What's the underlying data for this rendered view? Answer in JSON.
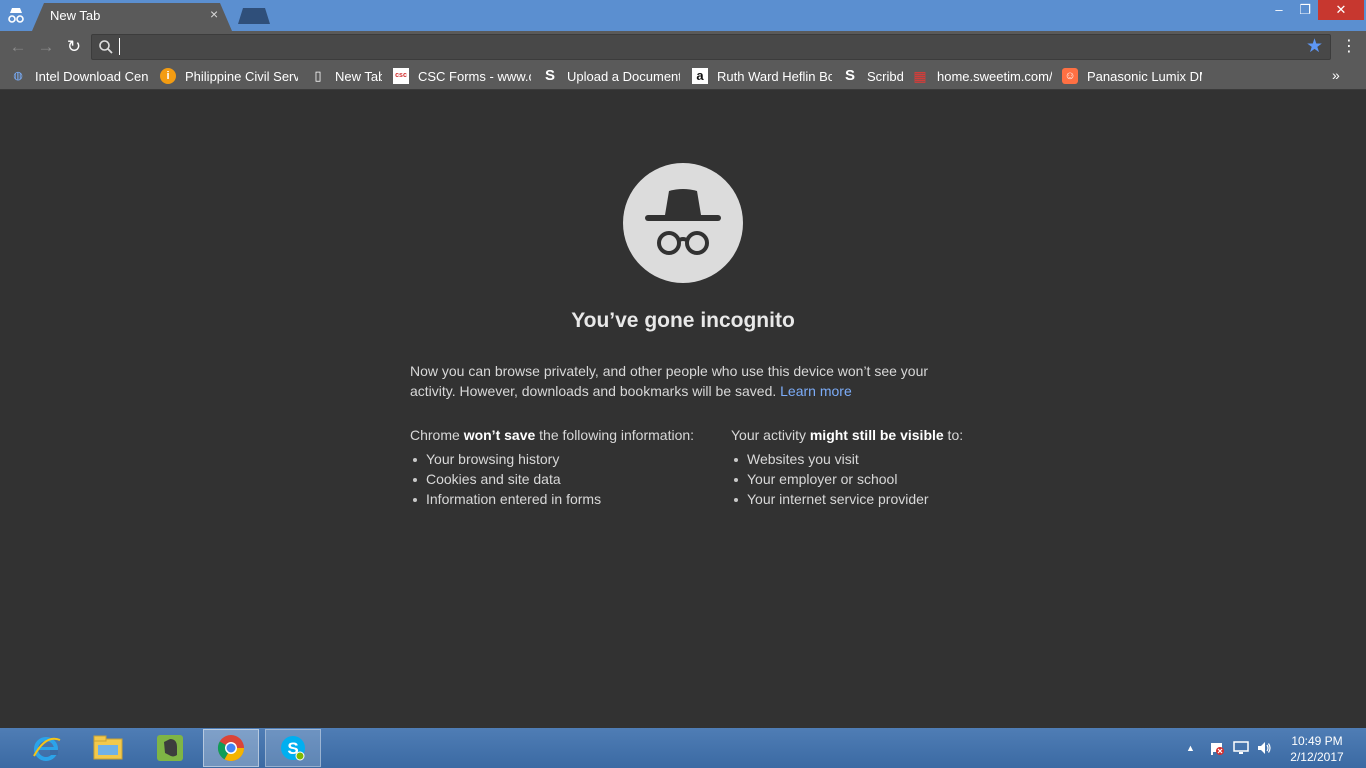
{
  "browser": {
    "tab_title": "New Tab",
    "tab_close": "×",
    "window_min": "–",
    "window_restore": "❐",
    "window_close": "✕"
  },
  "toolbar": {
    "back": "←",
    "forward": "→",
    "reload": "↻",
    "omnibox_value": "",
    "star": "★",
    "menu": "⋮"
  },
  "bookmarks": [
    {
      "label": "Intel Download Cente",
      "icon": "intel-icon",
      "glyph": "◍",
      "color": "#7ab0ff"
    },
    {
      "label": "Philippine Civil Servic",
      "icon": "csc-orange-icon",
      "glyph": "i",
      "color": "#f39c12"
    },
    {
      "label": "New Tab",
      "icon": "page-icon",
      "glyph": "▯",
      "color": "#ffffff"
    },
    {
      "label": "CSC Forms - www.csc",
      "icon": "csc-forms-icon",
      "glyph": "csc",
      "color": "#d32f2f"
    },
    {
      "label": "Upload a Document |",
      "icon": "scribd-icon",
      "glyph": "S",
      "color": "#ffffff"
    },
    {
      "label": "Ruth Ward Heflin Boo",
      "icon": "amazon-icon",
      "glyph": "a",
      "color": "#ffffff"
    },
    {
      "label": "Scribd",
      "icon": "scribd-icon",
      "glyph": "S",
      "color": "#ffffff"
    },
    {
      "label": "home.sweetim.com/?",
      "icon": "sweetim-icon",
      "glyph": "▦",
      "color": "#e53935"
    },
    {
      "label": "Panasonic Lumix DM",
      "icon": "panasonic-icon",
      "glyph": "☺",
      "color": "#ff7043"
    }
  ],
  "bookmarks_more": "»",
  "page": {
    "heading": "You’ve gone incognito",
    "intro": "Now you can browse privately, and other people who use this device won’t see your activity. However, downloads and bookmarks will be saved.",
    "learn_more": "Learn more",
    "left_pre": "Chrome ",
    "left_bold": "won’t save",
    "left_post": " the following information:",
    "left_items": [
      "Your browsing history",
      "Cookies and site data",
      "Information entered in forms"
    ],
    "right_pre": "Your activity ",
    "right_bold": "might still be visible",
    "right_post": " to:",
    "right_items": [
      "Websites you visit",
      "Your employer or school",
      "Your internet service provider"
    ]
  },
  "taskbar": {
    "tray_arrow": "▲",
    "time": "10:49 PM",
    "date": "2/12/2017"
  },
  "colors": {
    "page_bg": "#323232",
    "tab_bg": "#5a5a5a",
    "titlebar_bg": "#5b8fd0",
    "link": "#7cacf8",
    "close_red": "#c7372f"
  }
}
